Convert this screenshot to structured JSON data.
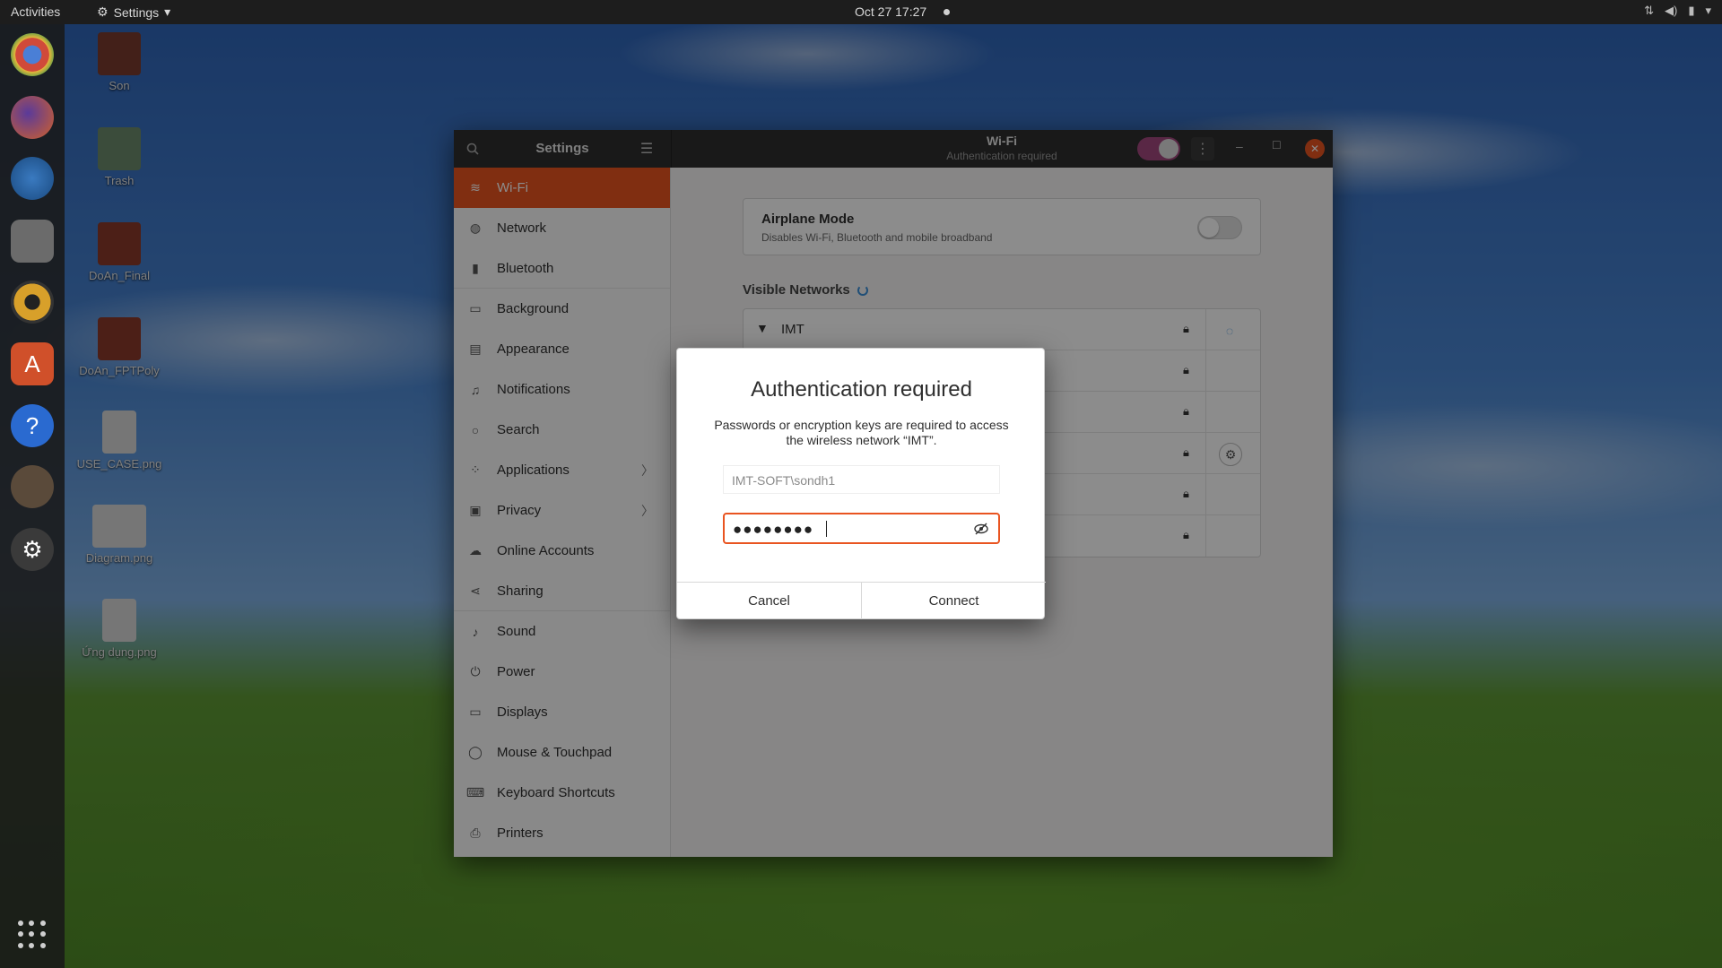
{
  "topbar": {
    "activities": "Activities",
    "app_menu": "Settings",
    "clock": "Oct 27  17:27"
  },
  "desktop_icons": [
    "Son",
    "Trash",
    "DoAn_Final",
    "DoAn_FPTPoly",
    "USE_CASE.png",
    "Diagram.png",
    "Ứng dụng.png"
  ],
  "window": {
    "sidebar_title": "Settings",
    "title": "Wi-Fi",
    "subtitle": "Authentication required"
  },
  "sidebar": {
    "items": [
      {
        "label": "Wi-Fi",
        "icon": "wifi-icon"
      },
      {
        "label": "Network",
        "icon": "network-icon"
      },
      {
        "label": "Bluetooth",
        "icon": "bluetooth-icon"
      },
      {
        "label": "Background",
        "icon": "background-icon"
      },
      {
        "label": "Appearance",
        "icon": "appearance-icon"
      },
      {
        "label": "Notifications",
        "icon": "bell-icon"
      },
      {
        "label": "Search",
        "icon": "search-icon"
      },
      {
        "label": "Applications",
        "icon": "apps-icon"
      },
      {
        "label": "Privacy",
        "icon": "lock-icon"
      },
      {
        "label": "Online Accounts",
        "icon": "cloud-icon"
      },
      {
        "label": "Sharing",
        "icon": "share-icon"
      },
      {
        "label": "Sound",
        "icon": "music-icon"
      },
      {
        "label": "Power",
        "icon": "power-icon"
      },
      {
        "label": "Displays",
        "icon": "display-icon"
      },
      {
        "label": "Mouse & Touchpad",
        "icon": "mouse-icon"
      },
      {
        "label": "Keyboard Shortcuts",
        "icon": "keyboard-icon"
      },
      {
        "label": "Printers",
        "icon": "printer-icon"
      }
    ]
  },
  "airplane": {
    "title": "Airplane Mode",
    "subtitle": "Disables Wi-Fi, Bluetooth and mobile broadband",
    "enabled": false
  },
  "networks": {
    "heading": "Visible Networks",
    "first_name": "IMT"
  },
  "dialog": {
    "title": "Authentication required",
    "message": "Passwords or encryption keys are required to access the wireless network “IMT”.",
    "username": "IMT-SOFT\\sondh1",
    "password_mask": "●●●●●●●●",
    "cancel": "Cancel",
    "connect": "Connect"
  },
  "colors": {
    "accent": "#e95420",
    "wifi_toggle": "#a3477f",
    "spinner": "#3a8fd9"
  }
}
